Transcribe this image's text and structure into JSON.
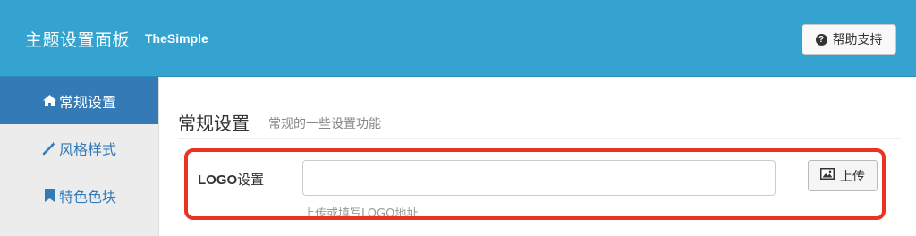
{
  "header": {
    "title": "主题设置面板",
    "subtitle": "TheSimple",
    "help_button": {
      "icon": "question-circle-icon",
      "label": "帮助支持"
    }
  },
  "sidebar": {
    "items": [
      {
        "icon": "home-icon",
        "label": "常规设置",
        "active": true
      },
      {
        "icon": "magic-wand-icon",
        "label": "风格样式",
        "active": false
      },
      {
        "icon": "bookmark-icon",
        "label": "特色色块",
        "active": false
      }
    ]
  },
  "main": {
    "section_title": "常规设置",
    "section_desc": "常规的一些设置功能",
    "logo_field": {
      "label_prefix": "LOGO",
      "label_suffix": "设置",
      "value": "",
      "help": "上传或填写LOGO地址",
      "upload_label": "上传",
      "upload_icon": "image-icon"
    }
  },
  "colors": {
    "header_bg": "#34a3d0",
    "sidebar_active": "#337ab7",
    "sidebar_bg": "#ececec",
    "highlight": "#ea3323"
  }
}
